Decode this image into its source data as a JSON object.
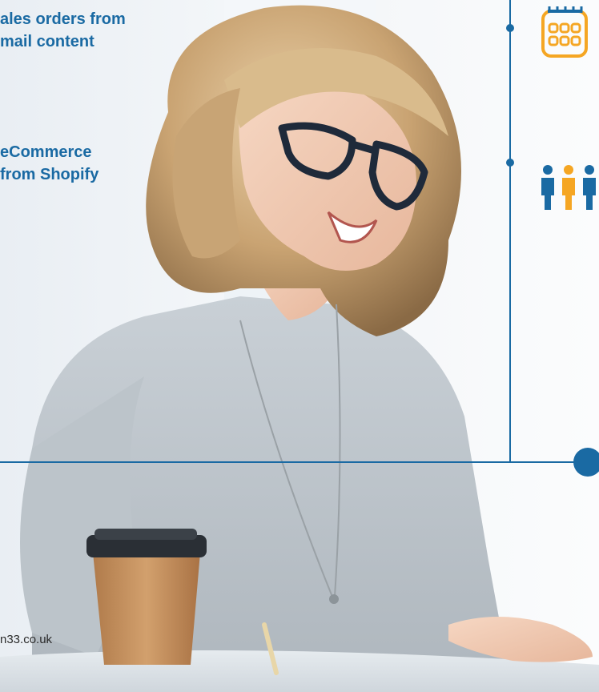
{
  "features": [
    {
      "line1": "ales orders from",
      "line2": "mail content"
    },
    {
      "line1": "eCommerce",
      "line2": "from Shopify"
    }
  ],
  "icons": {
    "calendar": "calendar-icon",
    "people": "team-people-icon"
  },
  "colors": {
    "brand_blue": "#1a6aa3",
    "accent_orange": "#f5a623"
  },
  "footer": {
    "url": "n33.co.uk"
  }
}
